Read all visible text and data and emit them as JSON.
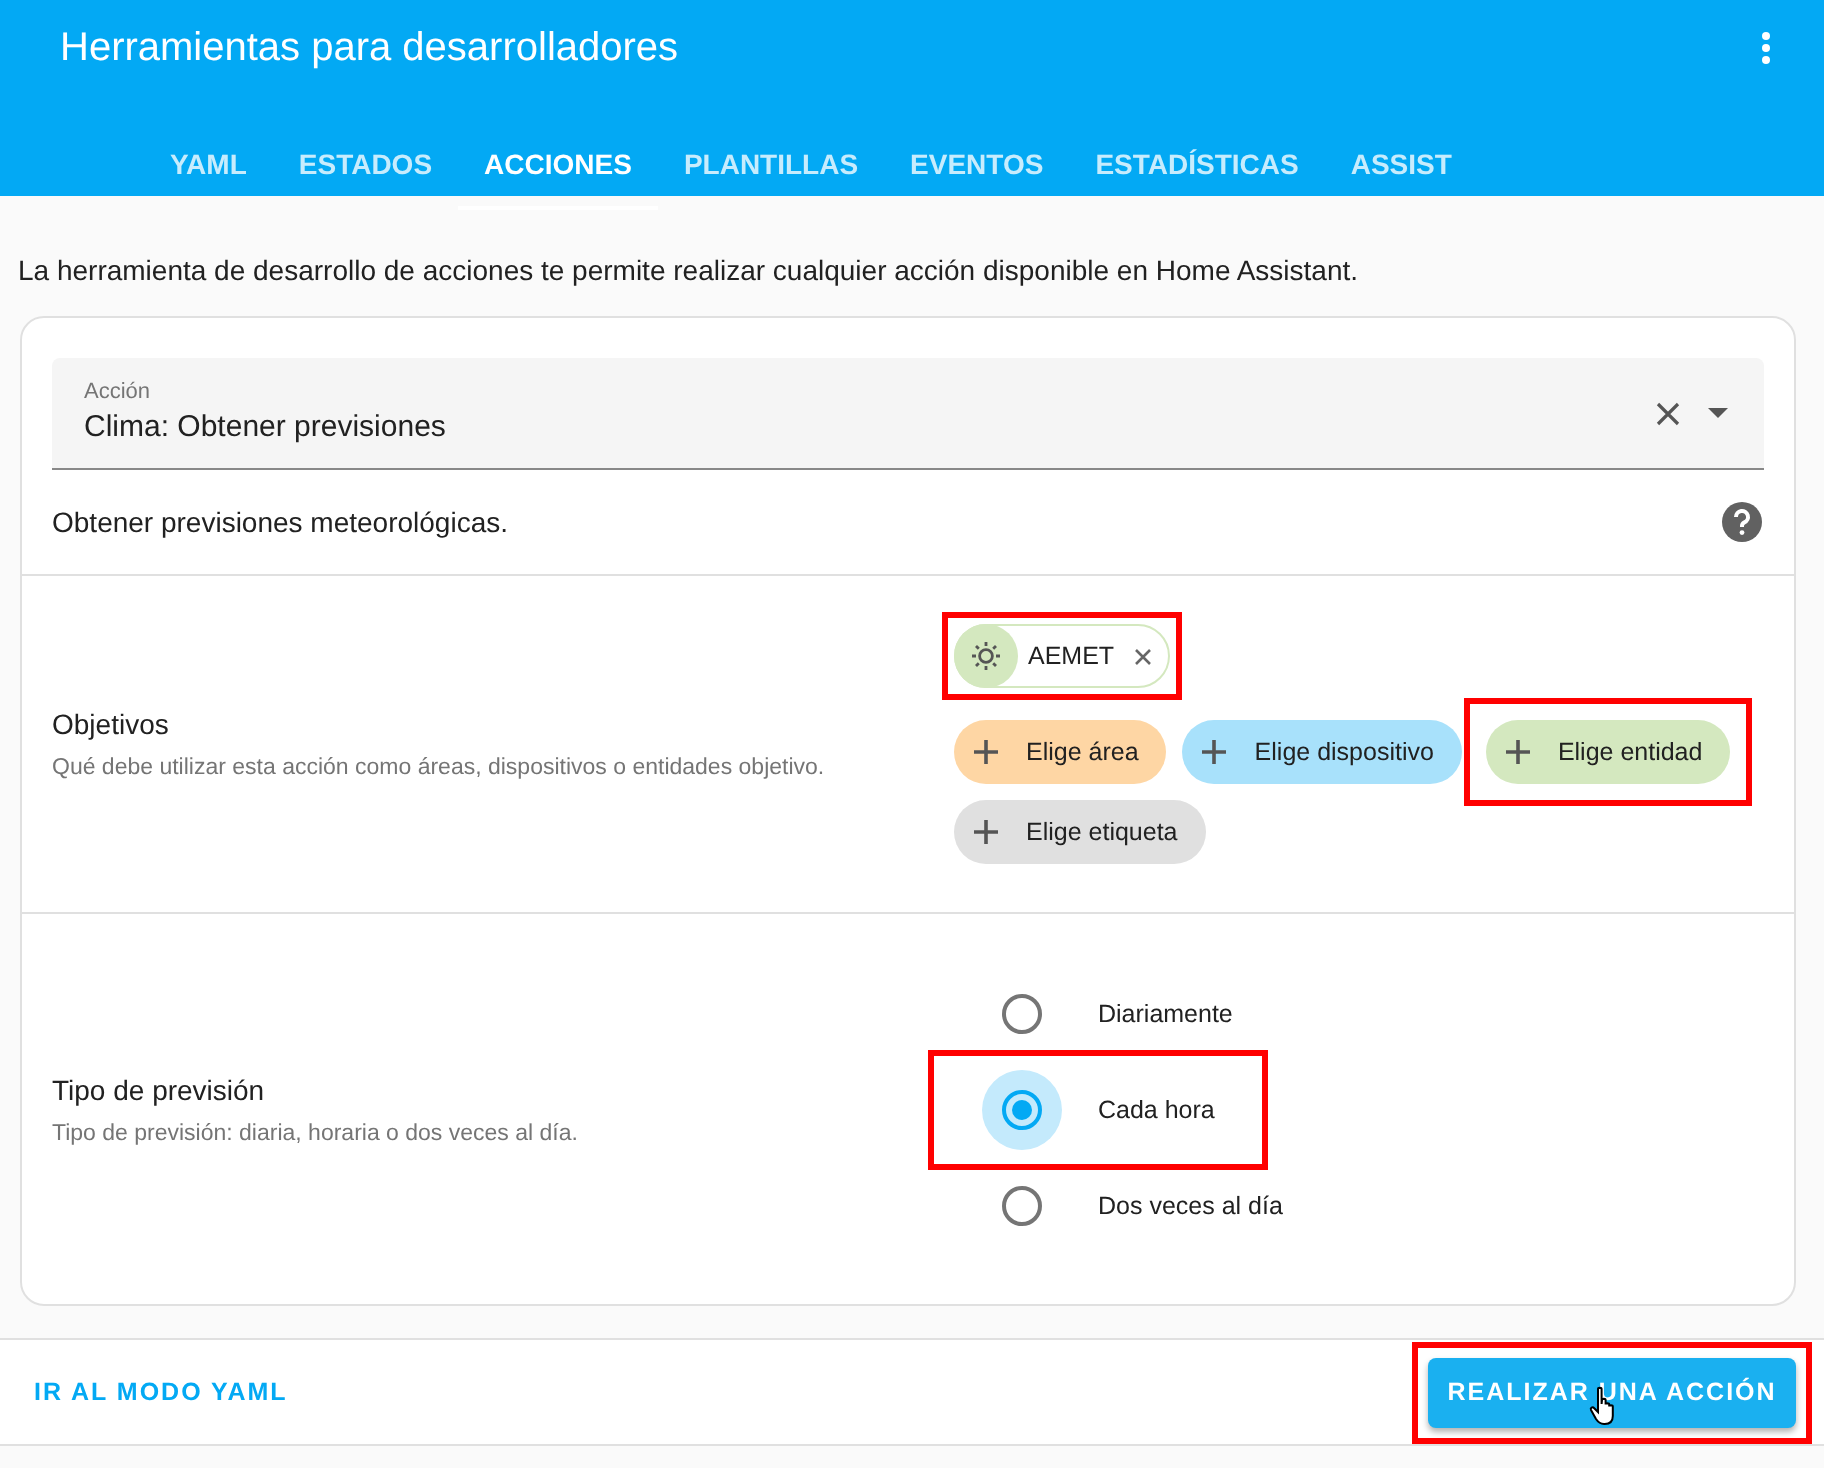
{
  "header": {
    "title": "Herramientas para desarrolladores",
    "tabs": [
      {
        "label": "YAML",
        "selected": false
      },
      {
        "label": "ESTADOS",
        "selected": false
      },
      {
        "label": "ACCIONES",
        "selected": true
      },
      {
        "label": "PLANTILLAS",
        "selected": false
      },
      {
        "label": "EVENTOS",
        "selected": false
      },
      {
        "label": "ESTADÍSTICAS",
        "selected": false
      },
      {
        "label": "ASSIST",
        "selected": false
      }
    ]
  },
  "intro": "La herramienta de desarrollo de acciones te permite realizar cualquier acción disponible en Home Assistant.",
  "action_field": {
    "label": "Acción",
    "value": "Clima: Obtener previsiones"
  },
  "action_description": "Obtener previsiones meteorológicas.",
  "targets": {
    "title": "Objetivos",
    "description": "Qué debe utilizar esta acción como áreas, dispositivos o entidades objetivo.",
    "selected": [
      {
        "label": "AEMET",
        "highlighted": true
      }
    ],
    "pickers": [
      {
        "label": "Elige área",
        "color": "#fed6a4",
        "highlighted": false
      },
      {
        "label": "Elige dispositivo",
        "color": "#a8e1fb",
        "highlighted": false
      },
      {
        "label": "Elige entidad",
        "color": "#d4e8bf",
        "highlighted": true
      },
      {
        "label": "Elige etiqueta",
        "color": "#e0e0e0",
        "highlighted": false
      }
    ]
  },
  "forecast_type": {
    "title": "Tipo de previsión",
    "description": "Tipo de previsión: diaria, horaria o dos veces al día.",
    "options": [
      {
        "label": "Diariamente",
        "selected": false,
        "highlighted": false
      },
      {
        "label": "Cada hora",
        "selected": true,
        "highlighted": true
      },
      {
        "label": "Dos veces al día",
        "selected": false,
        "highlighted": false
      }
    ]
  },
  "footer": {
    "yaml_link": "IR AL MODO YAML",
    "run_button": {
      "label": "REALIZAR UNA ACCIÓN",
      "highlighted": true
    }
  }
}
